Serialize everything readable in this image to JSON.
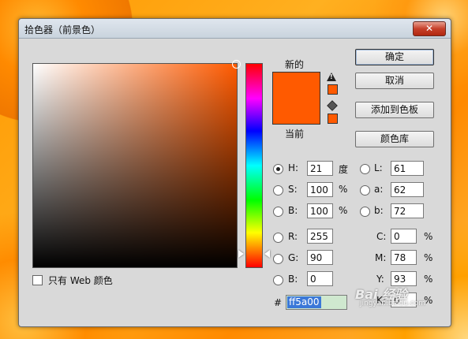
{
  "window": {
    "title": "拾色器（前景色）",
    "close_label": "✕"
  },
  "preview": {
    "new_label": "新的",
    "current_label": "当前",
    "new_color": "#ff5a00",
    "current_color": "#ff5a00"
  },
  "buttons": {
    "ok": "确定",
    "cancel": "取消",
    "add_to_swatches": "添加到色板",
    "color_libraries": "颜色库"
  },
  "hsb": {
    "h": {
      "label": "H:",
      "value": "21",
      "unit": "度"
    },
    "s": {
      "label": "S:",
      "value": "100",
      "unit": "%"
    },
    "b": {
      "label": "B:",
      "value": "100",
      "unit": "%"
    }
  },
  "rgb": {
    "r": {
      "label": "R:",
      "value": "255"
    },
    "g": {
      "label": "G:",
      "value": "90"
    },
    "b": {
      "label": "B:",
      "value": "0"
    }
  },
  "lab": {
    "l": {
      "label": "L:",
      "value": "61"
    },
    "a": {
      "label": "a:",
      "value": "62"
    },
    "b": {
      "label": "b:",
      "value": "72"
    }
  },
  "cmyk": {
    "c": {
      "label": "C:",
      "value": "0",
      "unit": "%"
    },
    "m": {
      "label": "M:",
      "value": "78",
      "unit": "%"
    },
    "y": {
      "label": "Y:",
      "value": "93",
      "unit": "%"
    },
    "k": {
      "label": "K:",
      "value": "0",
      "unit": "%"
    }
  },
  "hex": {
    "label": "#",
    "value": "ff5a00"
  },
  "web_only": {
    "label": "只有 Web 颜色",
    "checked": false
  },
  "watermark": {
    "text": "Bai 经验",
    "sub": "jingyan.baidu.com"
  }
}
